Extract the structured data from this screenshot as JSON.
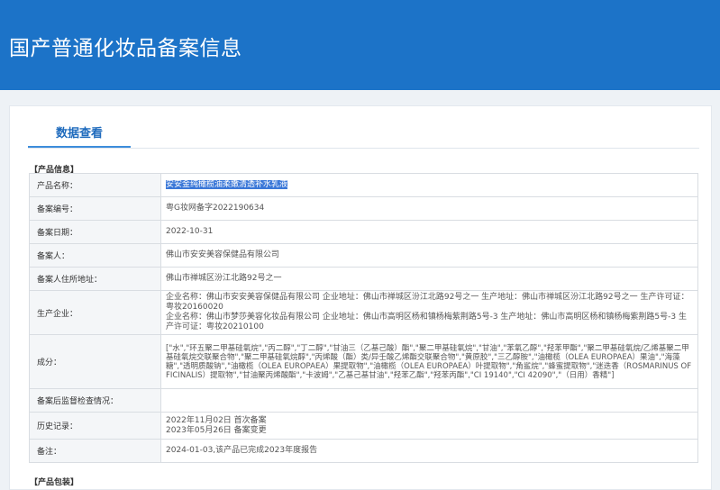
{
  "header": {
    "title": "国产普通化妆品备案信息"
  },
  "tabs": {
    "active_label": "数据查看"
  },
  "product_info": {
    "section_label": "【产品信息】",
    "rows": {
      "name": {
        "label": "产品名称：",
        "value": "安安金纯橄榄油柔嫩清透补水乳液"
      },
      "number": {
        "label": "备案编号：",
        "value": "粤G妆网备字2022190634"
      },
      "date": {
        "label": "备案日期：",
        "value": "2022-10-31"
      },
      "registrant": {
        "label": "备案人：",
        "value": "佛山市安安美容保健品有限公司"
      },
      "address": {
        "label": "备案人住所地址：",
        "value": "佛山市禅城区汾江北路92号之一"
      },
      "manufacturer": {
        "label": "生产企业：",
        "lines": [
          "企业名称：佛山市安安美容保健品有限公司 企业地址：佛山市禅城区汾江北路92号之一 生产地址：佛山市禅城区汾江北路92号之一 生产许可证：粤妆20160020",
          "企业名称：佛山市梦莎美容化妆品有限公司 企业地址：佛山市高明区杨和镇杨梅紫荆路5号-3 生产地址：佛山市高明区杨和镇杨梅紫荆路5号-3 生产许可证：粤妆20210100"
        ]
      },
      "ingredients": {
        "label": "成分：",
        "value": "[\"水\",\"环五聚二甲基硅氧烷\",\"丙二醇\",\"丁二醇\",\"甘油三（乙基己酸）酯\",\"聚二甲基硅氧烷\",\"甘油\",\"苯氧乙醇\",\"羟苯甲酯\",\"聚二甲基硅氧烷/乙烯基聚二甲基硅氧烷交联聚合物\",\"聚二甲基硅氧烷醇\",\"丙烯酸（酯）类/异壬酸乙烯酯交联聚合物\",\"黄原胶\",\"三乙醇胺\",\"油橄榄（OLEA EUROPAEA）果油\",\"海藻糖\",\"透明质酸钠\",\"油橄榄（OLEA EUROPAEA）果提取物\",\"油橄榄（OLEA EUROPAEA）叶提取物\",\"角鲨烷\",\"蜂蜜提取物\",\"迷迭香（ROSMARINUS OFFICINALIS）提取物\",\"甘油聚丙烯酸酯\",\"卡波姆\",\"乙基己基甘油\",\"羟苯乙酯\",\"羟苯丙酯\",\"CI 19140\",\"CI 42090\",\"（日用）香精\"]"
      },
      "post_check": {
        "label": "备案后监督检查情况：",
        "value": ""
      },
      "history": {
        "label": "历史记录：",
        "lines": [
          "2022年11月02日 首次备案",
          "2023年05月26日 备案变更"
        ]
      },
      "remarks": {
        "label": "备注：",
        "value": "2024-01-03,该产品已完成2023年度报告"
      }
    }
  },
  "packaging": {
    "section_label": "【产品包装】"
  }
}
